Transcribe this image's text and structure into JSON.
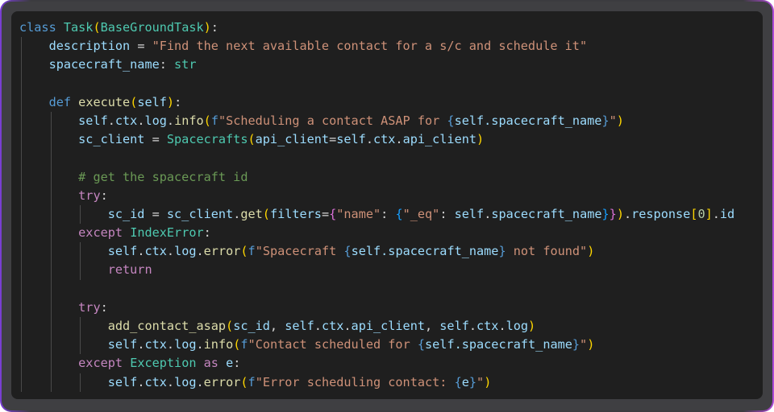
{
  "code_lines": [
    [
      {
        "t": "class",
        "c": "kw"
      },
      {
        "t": " "
      },
      {
        "t": "Task",
        "c": "cls"
      },
      {
        "t": "(",
        "c": "br1"
      },
      {
        "t": "BaseGroundTask",
        "c": "cls"
      },
      {
        "t": ")",
        "c": "br1"
      },
      {
        "t": ":"
      }
    ],
    [
      {
        "t": "    "
      },
      {
        "t": "description",
        "c": "var"
      },
      {
        "t": " = "
      },
      {
        "t": "\"Find the next available contact for a s/c and schedule it\"",
        "c": "str"
      }
    ],
    [
      {
        "t": "    "
      },
      {
        "t": "spacecraft_name",
        "c": "var"
      },
      {
        "t": ": "
      },
      {
        "t": "str",
        "c": "cls"
      }
    ],
    [],
    [
      {
        "t": "    "
      },
      {
        "t": "def",
        "c": "kw"
      },
      {
        "t": " "
      },
      {
        "t": "execute",
        "c": "fn"
      },
      {
        "t": "(",
        "c": "br1"
      },
      {
        "t": "self",
        "c": "var"
      },
      {
        "t": ")",
        "c": "br1"
      },
      {
        "t": ":"
      }
    ],
    [
      {
        "t": "        "
      },
      {
        "t": "self",
        "c": "var"
      },
      {
        "t": "."
      },
      {
        "t": "ctx",
        "c": "var"
      },
      {
        "t": "."
      },
      {
        "t": "log",
        "c": "var"
      },
      {
        "t": "."
      },
      {
        "t": "info",
        "c": "fn"
      },
      {
        "t": "(",
        "c": "br1"
      },
      {
        "t": "f",
        "c": "fpre"
      },
      {
        "t": "\"Scheduling a contact ASAP for ",
        "c": "str"
      },
      {
        "t": "{",
        "c": "kw"
      },
      {
        "t": "self.spacecraft_name",
        "c": "fexp"
      },
      {
        "t": "}",
        "c": "kw"
      },
      {
        "t": "\"",
        "c": "str"
      },
      {
        "t": ")",
        "c": "br1"
      }
    ],
    [
      {
        "t": "        "
      },
      {
        "t": "sc_client",
        "c": "var"
      },
      {
        "t": " = "
      },
      {
        "t": "Spacecrafts",
        "c": "cls"
      },
      {
        "t": "(",
        "c": "br1"
      },
      {
        "t": "api_client",
        "c": "var"
      },
      {
        "t": "="
      },
      {
        "t": "self",
        "c": "var"
      },
      {
        "t": "."
      },
      {
        "t": "ctx",
        "c": "var"
      },
      {
        "t": "."
      },
      {
        "t": "api_client",
        "c": "var"
      },
      {
        "t": ")",
        "c": "br1"
      }
    ],
    [],
    [
      {
        "t": "        "
      },
      {
        "t": "# get the spacecraft id",
        "c": "cmt"
      }
    ],
    [
      {
        "t": "        "
      },
      {
        "t": "try",
        "c": "ctl"
      },
      {
        "t": ":"
      }
    ],
    [
      {
        "t": "            "
      },
      {
        "t": "sc_id",
        "c": "var"
      },
      {
        "t": " = "
      },
      {
        "t": "sc_client",
        "c": "var"
      },
      {
        "t": "."
      },
      {
        "t": "get",
        "c": "fn"
      },
      {
        "t": "(",
        "c": "br1"
      },
      {
        "t": "filters",
        "c": "var"
      },
      {
        "t": "="
      },
      {
        "t": "{",
        "c": "br2"
      },
      {
        "t": "\"name\"",
        "c": "str"
      },
      {
        "t": ": "
      },
      {
        "t": "{",
        "c": "br3"
      },
      {
        "t": "\"_eq\"",
        "c": "str"
      },
      {
        "t": ": "
      },
      {
        "t": "self",
        "c": "var"
      },
      {
        "t": "."
      },
      {
        "t": "spacecraft_name",
        "c": "var"
      },
      {
        "t": "}",
        "c": "br3"
      },
      {
        "t": "}",
        "c": "br2"
      },
      {
        "t": ")",
        "c": "br1"
      },
      {
        "t": "."
      },
      {
        "t": "response",
        "c": "var"
      },
      {
        "t": "[",
        "c": "br1"
      },
      {
        "t": "0",
        "c": "num"
      },
      {
        "t": "]",
        "c": "br1"
      },
      {
        "t": "."
      },
      {
        "t": "id",
        "c": "var"
      }
    ],
    [
      {
        "t": "        "
      },
      {
        "t": "except",
        "c": "ctl"
      },
      {
        "t": " "
      },
      {
        "t": "IndexError",
        "c": "cls"
      },
      {
        "t": ":"
      }
    ],
    [
      {
        "t": "            "
      },
      {
        "t": "self",
        "c": "var"
      },
      {
        "t": "."
      },
      {
        "t": "ctx",
        "c": "var"
      },
      {
        "t": "."
      },
      {
        "t": "log",
        "c": "var"
      },
      {
        "t": "."
      },
      {
        "t": "error",
        "c": "fn"
      },
      {
        "t": "(",
        "c": "br1"
      },
      {
        "t": "f",
        "c": "fpre"
      },
      {
        "t": "\"Spacecraft ",
        "c": "str"
      },
      {
        "t": "{",
        "c": "kw"
      },
      {
        "t": "self.spacecraft_name",
        "c": "fexp"
      },
      {
        "t": "}",
        "c": "kw"
      },
      {
        "t": " not found\"",
        "c": "str"
      },
      {
        "t": ")",
        "c": "br1"
      }
    ],
    [
      {
        "t": "            "
      },
      {
        "t": "return",
        "c": "ctl"
      }
    ],
    [],
    [
      {
        "t": "        "
      },
      {
        "t": "try",
        "c": "ctl"
      },
      {
        "t": ":"
      }
    ],
    [
      {
        "t": "            "
      },
      {
        "t": "add_contact_asap",
        "c": "fn"
      },
      {
        "t": "(",
        "c": "br1"
      },
      {
        "t": "sc_id",
        "c": "var"
      },
      {
        "t": ", "
      },
      {
        "t": "self",
        "c": "var"
      },
      {
        "t": "."
      },
      {
        "t": "ctx",
        "c": "var"
      },
      {
        "t": "."
      },
      {
        "t": "api_client",
        "c": "var"
      },
      {
        "t": ", "
      },
      {
        "t": "self",
        "c": "var"
      },
      {
        "t": "."
      },
      {
        "t": "ctx",
        "c": "var"
      },
      {
        "t": "."
      },
      {
        "t": "log",
        "c": "var"
      },
      {
        "t": ")",
        "c": "br1"
      }
    ],
    [
      {
        "t": "            "
      },
      {
        "t": "self",
        "c": "var"
      },
      {
        "t": "."
      },
      {
        "t": "ctx",
        "c": "var"
      },
      {
        "t": "."
      },
      {
        "t": "log",
        "c": "var"
      },
      {
        "t": "."
      },
      {
        "t": "info",
        "c": "fn"
      },
      {
        "t": "(",
        "c": "br1"
      },
      {
        "t": "f",
        "c": "fpre"
      },
      {
        "t": "\"Contact scheduled for ",
        "c": "str"
      },
      {
        "t": "{",
        "c": "kw"
      },
      {
        "t": "self.spacecraft_name",
        "c": "fexp"
      },
      {
        "t": "}",
        "c": "kw"
      },
      {
        "t": "\"",
        "c": "str"
      },
      {
        "t": ")",
        "c": "br1"
      }
    ],
    [
      {
        "t": "        "
      },
      {
        "t": "except",
        "c": "ctl"
      },
      {
        "t": " "
      },
      {
        "t": "Exception",
        "c": "cls"
      },
      {
        "t": " "
      },
      {
        "t": "as",
        "c": "ctl"
      },
      {
        "t": " "
      },
      {
        "t": "e",
        "c": "var"
      },
      {
        "t": ":"
      }
    ],
    [
      {
        "t": "            "
      },
      {
        "t": "self",
        "c": "var"
      },
      {
        "t": "."
      },
      {
        "t": "ctx",
        "c": "var"
      },
      {
        "t": "."
      },
      {
        "t": "log",
        "c": "var"
      },
      {
        "t": "."
      },
      {
        "t": "error",
        "c": "fn"
      },
      {
        "t": "(",
        "c": "br1"
      },
      {
        "t": "f",
        "c": "fpre"
      },
      {
        "t": "\"Error scheduling contact: ",
        "c": "str"
      },
      {
        "t": "{",
        "c": "kw"
      },
      {
        "t": "e",
        "c": "fexp"
      },
      {
        "t": "}",
        "c": "kw"
      },
      {
        "t": "\"",
        "c": "str"
      },
      {
        "t": ")",
        "c": "br1"
      }
    ]
  ]
}
